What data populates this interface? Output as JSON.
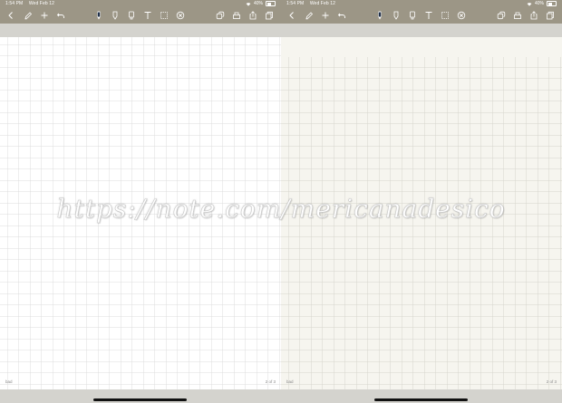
{
  "panes": [
    {
      "status": {
        "time": "1:54 PM",
        "date": "Wed Feb 12",
        "battery": "40%"
      },
      "footer": {
        "left": "bad",
        "right": "2 of 3"
      }
    },
    {
      "status": {
        "time": "1:54 PM",
        "date": "Wed Feb 12",
        "battery": "40%"
      },
      "footer": {
        "left": "bad",
        "right": "2 of 3"
      }
    }
  ],
  "toolbar_icons": [
    "back-icon",
    "pencil-icon",
    "add-icon",
    "undo-icon",
    "pen-icon",
    "marker-icon",
    "eraser-icon",
    "text-icon",
    "lasso-icon",
    "remove-icon",
    "pages-icon",
    "tray-icon",
    "share-icon",
    "copy-icon"
  ],
  "watermark": {
    "text": "https://note.com/mericanadesico"
  },
  "colors": {
    "toolbar": "#9c9686",
    "page_left": "#ffffff",
    "page_right": "#f6f5ef",
    "grid": "#dcdcdc",
    "pen_selected": "#20304a"
  }
}
